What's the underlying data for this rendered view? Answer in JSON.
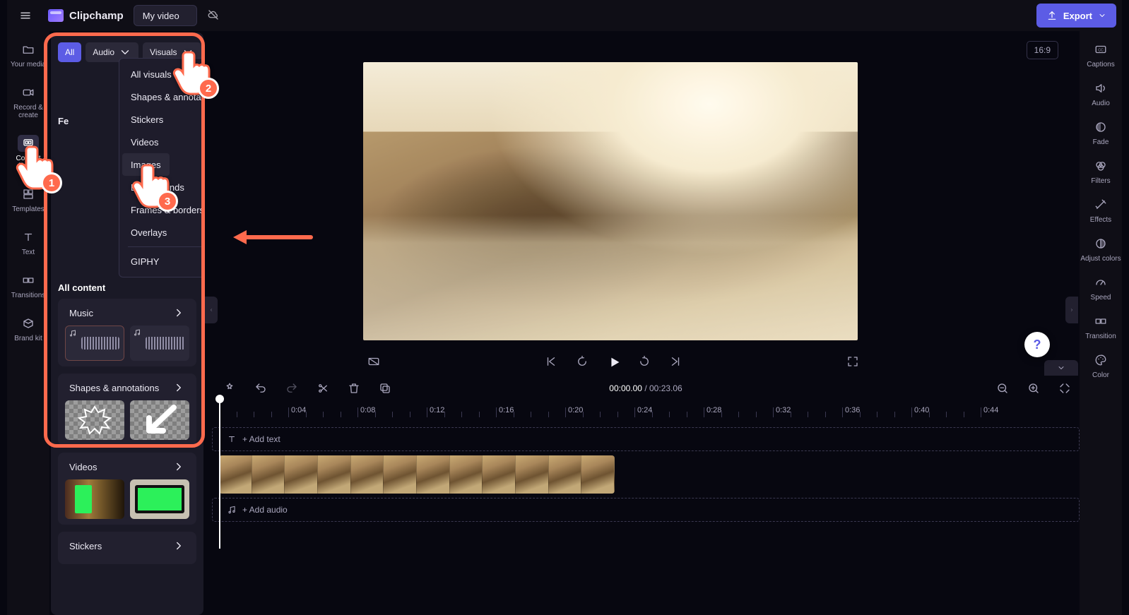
{
  "brand": "Clipchamp",
  "project_name": "My video",
  "export_label": "Export",
  "aspect_label": "16:9",
  "left_rail": [
    {
      "id": "your-media",
      "label": "Your media"
    },
    {
      "id": "record",
      "label": "Record & create"
    },
    {
      "id": "content-library",
      "label": "Content library"
    },
    {
      "id": "templates",
      "label": "Templates"
    },
    {
      "id": "text",
      "label": "Text"
    },
    {
      "id": "transitions",
      "label": "Transitions"
    },
    {
      "id": "brandkit",
      "label": "Brand kit"
    }
  ],
  "right_rail": [
    {
      "id": "captions",
      "label": "Captions"
    },
    {
      "id": "audio",
      "label": "Audio"
    },
    {
      "id": "fade",
      "label": "Fade"
    },
    {
      "id": "filters",
      "label": "Filters"
    },
    {
      "id": "effects",
      "label": "Effects"
    },
    {
      "id": "adjust",
      "label": "Adjust colors"
    },
    {
      "id": "speed",
      "label": "Speed"
    },
    {
      "id": "transition",
      "label": "Transition"
    },
    {
      "id": "color",
      "label": "Color"
    }
  ],
  "filters": {
    "all": "All",
    "audio": "Audio",
    "visuals": "Visuals"
  },
  "visuals_dropdown": [
    "All visuals",
    "Shapes & annotations",
    "Stickers",
    "Videos",
    "Images",
    "Backgrounds",
    "Frames & borders",
    "Overlays",
    "GIPHY"
  ],
  "visuals_selected_index": 4,
  "featured_heading": "Featured",
  "featured_visible": "Fe",
  "all_content_heading": "All content",
  "rows": [
    {
      "id": "music",
      "label": "Music"
    },
    {
      "id": "shapes",
      "label": "Shapes & annotations"
    },
    {
      "id": "videos",
      "label": "Videos"
    },
    {
      "id": "stickers",
      "label": "Stickers"
    }
  ],
  "timeline": {
    "current": "00:00.00",
    "total": "00:23.06",
    "ticks": [
      "0:04",
      "0:08",
      "0:12",
      "0:16",
      "0:20",
      "0:24",
      "0:28",
      "0:32",
      "0:36",
      "0:40",
      "0:44"
    ],
    "add_text": "+ Add text",
    "add_audio": "+ Add audio"
  },
  "callout_badges": [
    "1",
    "2",
    "3"
  ],
  "help": "?"
}
